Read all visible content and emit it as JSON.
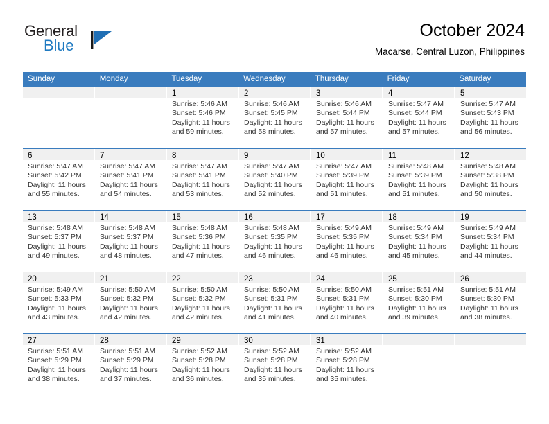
{
  "brand": {
    "name_part1": "General",
    "name_part2": "Blue",
    "logo_icon": "triangle-flag-icon"
  },
  "header": {
    "title": "October 2024",
    "subtitle": "Macarse, Central Luzon, Philippines"
  },
  "colors": {
    "header_blue": "#3a7cbe",
    "brand_blue": "#1f7ac1",
    "day_band_gray": "#f0f0f0",
    "text": "#333333"
  },
  "weekdays": [
    "Sunday",
    "Monday",
    "Tuesday",
    "Wednesday",
    "Thursday",
    "Friday",
    "Saturday"
  ],
  "labels": {
    "sunrise_prefix": "Sunrise:",
    "sunset_prefix": "Sunset:",
    "daylight_prefix": "Daylight:"
  },
  "weeks": [
    [
      {
        "day": "",
        "empty": true
      },
      {
        "day": "",
        "empty": true
      },
      {
        "day": "1",
        "sunrise": "Sunrise: 5:46 AM",
        "sunset": "Sunset: 5:46 PM",
        "daylight1": "Daylight: 11 hours",
        "daylight2": "and 59 minutes."
      },
      {
        "day": "2",
        "sunrise": "Sunrise: 5:46 AM",
        "sunset": "Sunset: 5:45 PM",
        "daylight1": "Daylight: 11 hours",
        "daylight2": "and 58 minutes."
      },
      {
        "day": "3",
        "sunrise": "Sunrise: 5:46 AM",
        "sunset": "Sunset: 5:44 PM",
        "daylight1": "Daylight: 11 hours",
        "daylight2": "and 57 minutes."
      },
      {
        "day": "4",
        "sunrise": "Sunrise: 5:47 AM",
        "sunset": "Sunset: 5:44 PM",
        "daylight1": "Daylight: 11 hours",
        "daylight2": "and 57 minutes."
      },
      {
        "day": "5",
        "sunrise": "Sunrise: 5:47 AM",
        "sunset": "Sunset: 5:43 PM",
        "daylight1": "Daylight: 11 hours",
        "daylight2": "and 56 minutes."
      }
    ],
    [
      {
        "day": "6",
        "sunrise": "Sunrise: 5:47 AM",
        "sunset": "Sunset: 5:42 PM",
        "daylight1": "Daylight: 11 hours",
        "daylight2": "and 55 minutes."
      },
      {
        "day": "7",
        "sunrise": "Sunrise: 5:47 AM",
        "sunset": "Sunset: 5:41 PM",
        "daylight1": "Daylight: 11 hours",
        "daylight2": "and 54 minutes."
      },
      {
        "day": "8",
        "sunrise": "Sunrise: 5:47 AM",
        "sunset": "Sunset: 5:41 PM",
        "daylight1": "Daylight: 11 hours",
        "daylight2": "and 53 minutes."
      },
      {
        "day": "9",
        "sunrise": "Sunrise: 5:47 AM",
        "sunset": "Sunset: 5:40 PM",
        "daylight1": "Daylight: 11 hours",
        "daylight2": "and 52 minutes."
      },
      {
        "day": "10",
        "sunrise": "Sunrise: 5:47 AM",
        "sunset": "Sunset: 5:39 PM",
        "daylight1": "Daylight: 11 hours",
        "daylight2": "and 51 minutes."
      },
      {
        "day": "11",
        "sunrise": "Sunrise: 5:48 AM",
        "sunset": "Sunset: 5:39 PM",
        "daylight1": "Daylight: 11 hours",
        "daylight2": "and 51 minutes."
      },
      {
        "day": "12",
        "sunrise": "Sunrise: 5:48 AM",
        "sunset": "Sunset: 5:38 PM",
        "daylight1": "Daylight: 11 hours",
        "daylight2": "and 50 minutes."
      }
    ],
    [
      {
        "day": "13",
        "sunrise": "Sunrise: 5:48 AM",
        "sunset": "Sunset: 5:37 PM",
        "daylight1": "Daylight: 11 hours",
        "daylight2": "and 49 minutes."
      },
      {
        "day": "14",
        "sunrise": "Sunrise: 5:48 AM",
        "sunset": "Sunset: 5:37 PM",
        "daylight1": "Daylight: 11 hours",
        "daylight2": "and 48 minutes."
      },
      {
        "day": "15",
        "sunrise": "Sunrise: 5:48 AM",
        "sunset": "Sunset: 5:36 PM",
        "daylight1": "Daylight: 11 hours",
        "daylight2": "and 47 minutes."
      },
      {
        "day": "16",
        "sunrise": "Sunrise: 5:48 AM",
        "sunset": "Sunset: 5:35 PM",
        "daylight1": "Daylight: 11 hours",
        "daylight2": "and 46 minutes."
      },
      {
        "day": "17",
        "sunrise": "Sunrise: 5:49 AM",
        "sunset": "Sunset: 5:35 PM",
        "daylight1": "Daylight: 11 hours",
        "daylight2": "and 46 minutes."
      },
      {
        "day": "18",
        "sunrise": "Sunrise: 5:49 AM",
        "sunset": "Sunset: 5:34 PM",
        "daylight1": "Daylight: 11 hours",
        "daylight2": "and 45 minutes."
      },
      {
        "day": "19",
        "sunrise": "Sunrise: 5:49 AM",
        "sunset": "Sunset: 5:34 PM",
        "daylight1": "Daylight: 11 hours",
        "daylight2": "and 44 minutes."
      }
    ],
    [
      {
        "day": "20",
        "sunrise": "Sunrise: 5:49 AM",
        "sunset": "Sunset: 5:33 PM",
        "daylight1": "Daylight: 11 hours",
        "daylight2": "and 43 minutes."
      },
      {
        "day": "21",
        "sunrise": "Sunrise: 5:50 AM",
        "sunset": "Sunset: 5:32 PM",
        "daylight1": "Daylight: 11 hours",
        "daylight2": "and 42 minutes."
      },
      {
        "day": "22",
        "sunrise": "Sunrise: 5:50 AM",
        "sunset": "Sunset: 5:32 PM",
        "daylight1": "Daylight: 11 hours",
        "daylight2": "and 42 minutes."
      },
      {
        "day": "23",
        "sunrise": "Sunrise: 5:50 AM",
        "sunset": "Sunset: 5:31 PM",
        "daylight1": "Daylight: 11 hours",
        "daylight2": "and 41 minutes."
      },
      {
        "day": "24",
        "sunrise": "Sunrise: 5:50 AM",
        "sunset": "Sunset: 5:31 PM",
        "daylight1": "Daylight: 11 hours",
        "daylight2": "and 40 minutes."
      },
      {
        "day": "25",
        "sunrise": "Sunrise: 5:51 AM",
        "sunset": "Sunset: 5:30 PM",
        "daylight1": "Daylight: 11 hours",
        "daylight2": "and 39 minutes."
      },
      {
        "day": "26",
        "sunrise": "Sunrise: 5:51 AM",
        "sunset": "Sunset: 5:30 PM",
        "daylight1": "Daylight: 11 hours",
        "daylight2": "and 38 minutes."
      }
    ],
    [
      {
        "day": "27",
        "sunrise": "Sunrise: 5:51 AM",
        "sunset": "Sunset: 5:29 PM",
        "daylight1": "Daylight: 11 hours",
        "daylight2": "and 38 minutes."
      },
      {
        "day": "28",
        "sunrise": "Sunrise: 5:51 AM",
        "sunset": "Sunset: 5:29 PM",
        "daylight1": "Daylight: 11 hours",
        "daylight2": "and 37 minutes."
      },
      {
        "day": "29",
        "sunrise": "Sunrise: 5:52 AM",
        "sunset": "Sunset: 5:28 PM",
        "daylight1": "Daylight: 11 hours",
        "daylight2": "and 36 minutes."
      },
      {
        "day": "30",
        "sunrise": "Sunrise: 5:52 AM",
        "sunset": "Sunset: 5:28 PM",
        "daylight1": "Daylight: 11 hours",
        "daylight2": "and 35 minutes."
      },
      {
        "day": "31",
        "sunrise": "Sunrise: 5:52 AM",
        "sunset": "Sunset: 5:28 PM",
        "daylight1": "Daylight: 11 hours",
        "daylight2": "and 35 minutes."
      },
      {
        "day": "",
        "empty": true
      },
      {
        "day": "",
        "empty": true
      }
    ]
  ]
}
